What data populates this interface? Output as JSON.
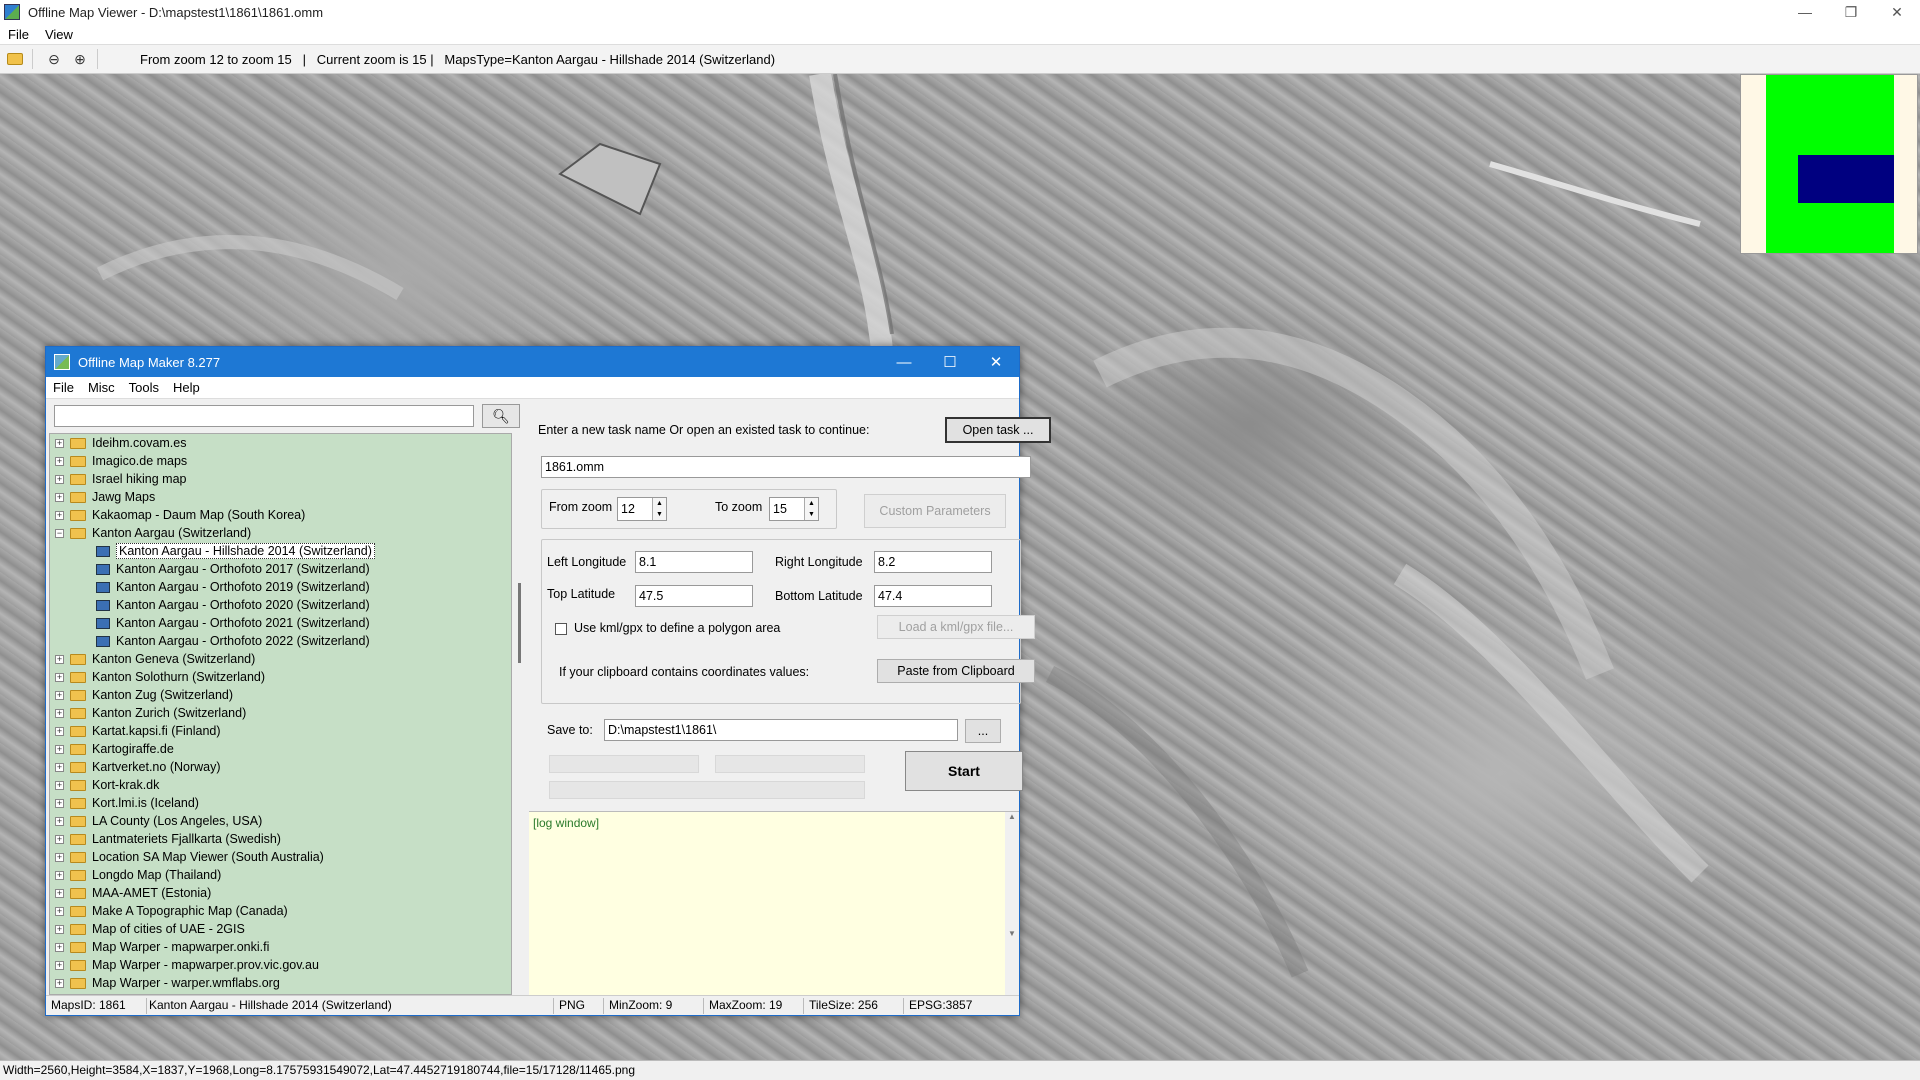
{
  "window": {
    "title": "Offline Map Viewer - D:\\mapstest1\\1861\\1861.omm",
    "controls": {
      "minimize": "—",
      "restore": "❐",
      "close": "✕"
    }
  },
  "menu": [
    "File",
    "View"
  ],
  "toolbar": {
    "info": "From zoom 12 to zoom 15   |   Current zoom is 15 |   MapsType=Kanton Aargau - Hillshade 2014 (Switzerland)"
  },
  "statusbar": {
    "text": "Width=2560,Height=3584,X=1837,Y=1968,Long=8.17575931549072,Lat=47.4452719180744,file=15/17128/11465.png"
  },
  "minimap_colors": {
    "bg": "#fff8e6",
    "area": "#00ff00",
    "view": "#000080"
  },
  "dialog": {
    "title": "Offline Map Maker 8.277",
    "controls": {
      "minimize": "—",
      "maximize": "☐",
      "close": "✕"
    },
    "menu": [
      "File",
      "Misc",
      "Tools",
      "Help"
    ],
    "search_placeholder": "",
    "tree": [
      {
        "label": "Ideihm.covam.es",
        "type": "folder",
        "exp": "+"
      },
      {
        "label": "Imagico.de maps",
        "type": "folder",
        "exp": "+"
      },
      {
        "label": "Israel hiking map",
        "type": "folder",
        "exp": "+"
      },
      {
        "label": "Jawg Maps",
        "type": "folder",
        "exp": "+"
      },
      {
        "label": "Kakaomap - Daum Map (South Korea)",
        "type": "folder",
        "exp": "+"
      },
      {
        "label": "Kanton Aargau (Switzerland)",
        "type": "folder",
        "exp": "−"
      },
      {
        "label": "Kanton Aargau - Hillshade 2014 (Switzerland)",
        "type": "map",
        "selected": true
      },
      {
        "label": "Kanton Aargau - Orthofoto 2017 (Switzerland)",
        "type": "map"
      },
      {
        "label": "Kanton Aargau - Orthofoto 2019 (Switzerland)",
        "type": "map"
      },
      {
        "label": "Kanton Aargau - Orthofoto 2020 (Switzerland)",
        "type": "map"
      },
      {
        "label": "Kanton Aargau - Orthofoto 2021 (Switzerland)",
        "type": "map"
      },
      {
        "label": "Kanton Aargau - Orthofoto 2022 (Switzerland)",
        "type": "map"
      },
      {
        "label": "Kanton Geneva (Switzerland)",
        "type": "folder",
        "exp": "+"
      },
      {
        "label": "Kanton Solothurn (Switzerland)",
        "type": "folder",
        "exp": "+"
      },
      {
        "label": "Kanton Zug (Switzerland)",
        "type": "folder",
        "exp": "+"
      },
      {
        "label": "Kanton Zurich (Switzerland)",
        "type": "folder",
        "exp": "+"
      },
      {
        "label": "Kartat.kapsi.fi (Finland)",
        "type": "folder",
        "exp": "+"
      },
      {
        "label": "Kartogiraffe.de",
        "type": "folder",
        "exp": "+"
      },
      {
        "label": "Kartverket.no (Norway)",
        "type": "folder",
        "exp": "+"
      },
      {
        "label": "Kort-krak.dk",
        "type": "folder",
        "exp": "+"
      },
      {
        "label": "Kort.lmi.is (Iceland)",
        "type": "folder",
        "exp": "+"
      },
      {
        "label": "LA County (Los Angeles, USA)",
        "type": "folder",
        "exp": "+"
      },
      {
        "label": "Lantmateriets Fjallkarta (Swedish)",
        "type": "folder",
        "exp": "+"
      },
      {
        "label": "Location SA Map Viewer (South Australia)",
        "type": "folder",
        "exp": "+"
      },
      {
        "label": "Longdo Map (Thailand)",
        "type": "folder",
        "exp": "+"
      },
      {
        "label": "MAA-AMET (Estonia)",
        "type": "folder",
        "exp": "+"
      },
      {
        "label": "Make A Topographic Map (Canada)",
        "type": "folder",
        "exp": "+"
      },
      {
        "label": "Map of cities of UAE - 2GIS",
        "type": "folder",
        "exp": "+"
      },
      {
        "label": "Map Warper - mapwarper.onki.fi",
        "type": "folder",
        "exp": "+"
      },
      {
        "label": "Map Warper - mapwarper.prov.vic.gov.au",
        "type": "folder",
        "exp": "+"
      },
      {
        "label": "Map Warper - warper.wmflabs.org",
        "type": "folder",
        "exp": "+"
      }
    ],
    "task_prompt": "Enter a new task name Or open an existed task to continue:",
    "open_task_label": "Open task ...",
    "task_name": "1861.omm",
    "from_zoom_label": "From zoom",
    "from_zoom": "12",
    "to_zoom_label": "To zoom",
    "to_zoom": "15",
    "custom_params_label": "Custom Parameters",
    "left_lon_label": "Left Longitude",
    "left_lon": "8.1",
    "right_lon_label": "Right Longitude",
    "right_lon": "8.2",
    "top_lat_label": "Top Latitude",
    "top_lat": "47.5",
    "bottom_lat_label": "Bottom Latitude",
    "bottom_lat": "47.4",
    "kml_check_label": "Use kml/gpx to define a polygon area",
    "load_kml_label": "Load a kml/gpx file...",
    "clipboard_prompt": "If your clipboard contains coordinates values:",
    "paste_label": "Paste from Clipboard",
    "save_to_label": "Save to:",
    "save_to": "D:\\mapstest1\\1861\\",
    "browse_label": "...",
    "start_label": "Start",
    "log_text": "[log window]",
    "status": {
      "maps_id": "MapsID: 1861",
      "map_name": "Kanton Aargau - Hillshade 2014 (Switzerland)",
      "format": "PNG",
      "min_zoom": "MinZoom: 9",
      "max_zoom": "MaxZoom: 19",
      "tile_size": "TileSize: 256",
      "epsg": "EPSG:3857"
    }
  }
}
